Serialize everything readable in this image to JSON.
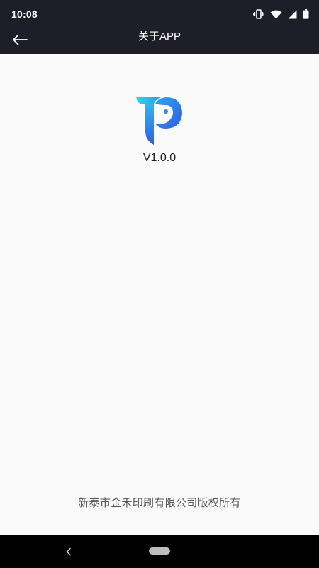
{
  "status_bar": {
    "time": "10:08",
    "icons": [
      "vibrate-icon",
      "wifi-icon",
      "signal-icon",
      "battery-icon"
    ]
  },
  "app_bar": {
    "title": "关于APP",
    "back_icon": "arrow-left-icon"
  },
  "about": {
    "logo_icon": "app-logo-icon",
    "version": "V1.0.0",
    "copyright": "新泰市金禾印刷有限公司版权所有"
  },
  "nav_bar": {
    "icons": [
      "nav-back-icon",
      "nav-home-pill-icon"
    ]
  },
  "colors": {
    "header_bg": "#1e1e29",
    "page_bg": "#fafafa",
    "logo_gradient_start": "#2ed8e6",
    "logo_gradient_end": "#2b5fe8"
  }
}
